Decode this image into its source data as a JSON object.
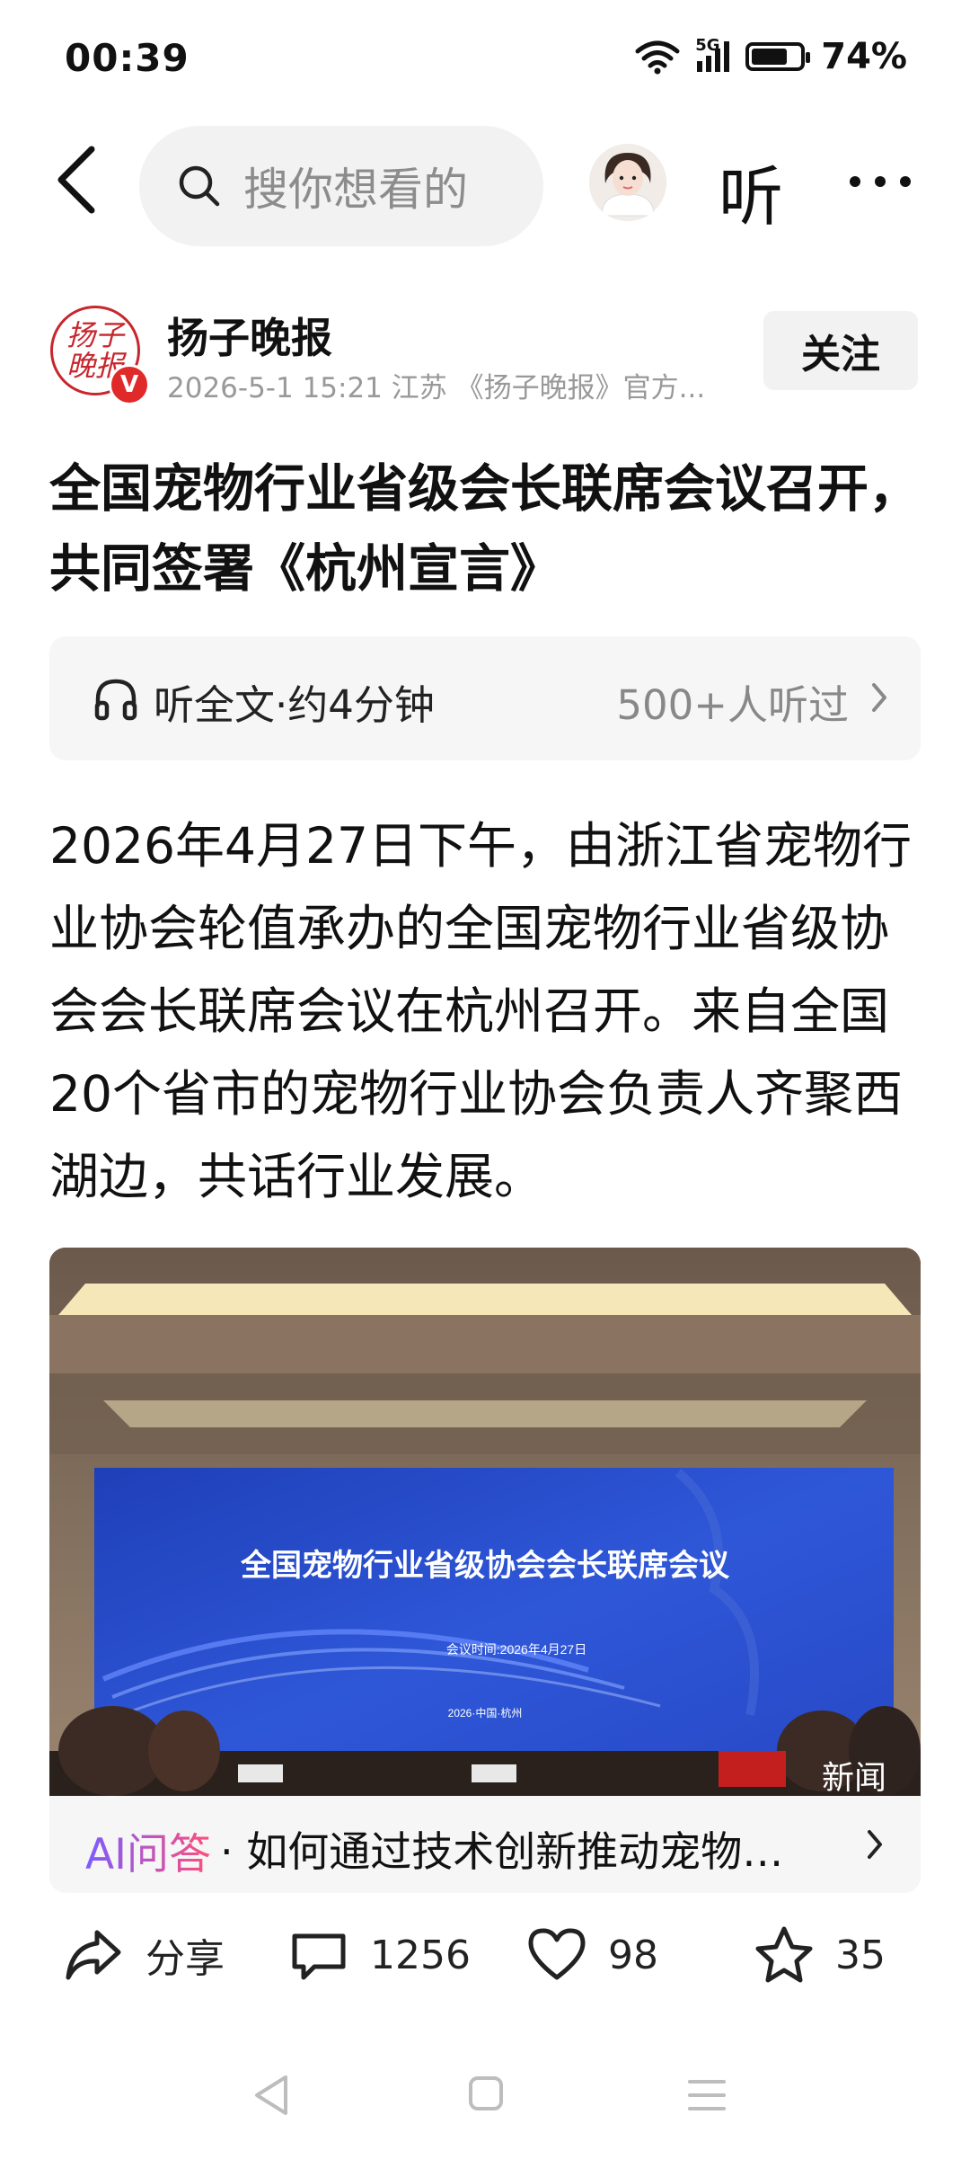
{
  "status_bar": {
    "time": "00:39",
    "network": "5G",
    "battery_percent_text": "74%",
    "battery_level": 0.74
  },
  "top_nav": {
    "search_placeholder": "搜你想看的",
    "listen_label": "听"
  },
  "author": {
    "logo_text": "扬子晚报",
    "verified_badge": "V",
    "name": "扬子晚报",
    "meta": "2026-5-1 15:21  江苏  《扬子晚报》官方...",
    "follow_label": "关注"
  },
  "article": {
    "title": "全国宠物行业省级会长联席会议召开，共同签署《杭州宣言》",
    "listen_full": "听全文·约4分钟",
    "listen_count": "500+人听过",
    "body": "2026年4月27日下午，由浙江省宠物行业协会轮值承办的全国宠物行业省级协会会长联席会议在杭州召开。来自全国20个省市的宠物行业协会负责人齐聚西湖边，共话行业发展。"
  },
  "photo": {
    "screen_title": "全国宠物行业省级协会会长联席会议",
    "screen_date": "会议时间:2026年4月27日",
    "screen_place": "2026·中国·杭州",
    "watermark": "新闻"
  },
  "ai_qa": {
    "tag": "AI问答",
    "question": "· 如何通过技术创新推动宠物产..."
  },
  "actions": {
    "share_label": "分享",
    "comments_count": "1256",
    "likes_count": "98",
    "favorites_count": "35"
  },
  "icons": [
    "back-arrow-icon",
    "search-icon",
    "more-icon",
    "headphones-icon",
    "chevron-right-icon",
    "share-icon",
    "comment-icon",
    "heart-icon",
    "star-icon",
    "nav-back-icon",
    "nav-home-icon",
    "nav-menu-icon"
  ]
}
